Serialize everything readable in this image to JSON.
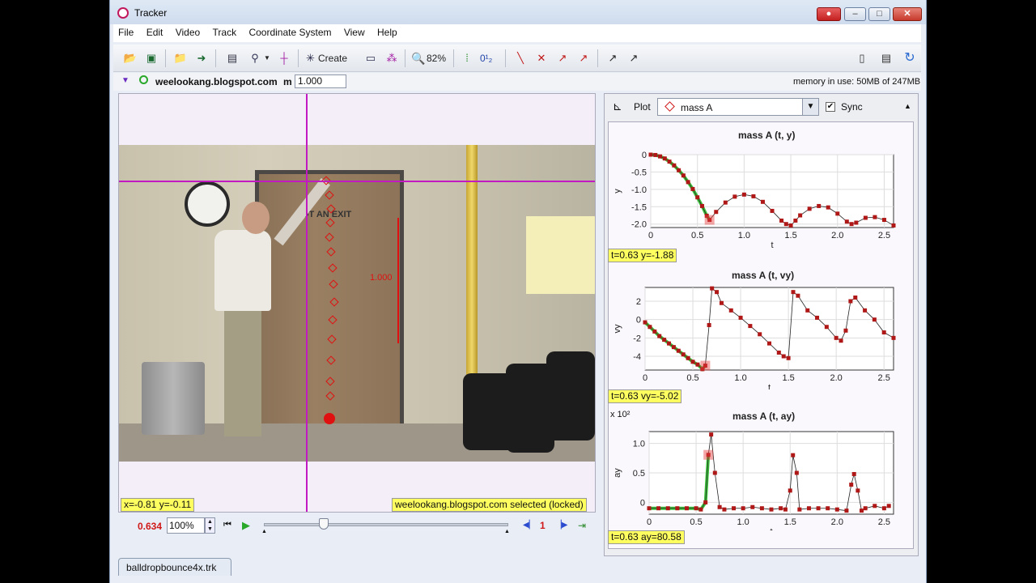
{
  "window": {
    "title": "Tracker"
  },
  "menu": [
    "File",
    "Edit",
    "Video",
    "Track",
    "Coordinate System",
    "View",
    "Help"
  ],
  "toolbar": {
    "create_label": "Create",
    "zoom": "82%",
    "coord_label": "0¹₂"
  },
  "trackbar": {
    "track_name": "weelookang.blogspot.com",
    "mass_label": "m",
    "mass_value": "1.000",
    "memory": "memory in use: 50MB of 247MB"
  },
  "video": {
    "door_text": "NOT AN EXIT",
    "scale_length": "1.000",
    "readout_xy": "x=-0.81  y=-0.11",
    "status": "weelookang.blogspot.com selected (locked)"
  },
  "playback": {
    "time": "0.634",
    "zoom": "100%",
    "step": "1"
  },
  "file_tab": "balldropbounce4x.trk",
  "plot_panel": {
    "plot_label": "Plot",
    "track": "mass A",
    "sync_label": "Sync",
    "plots": [
      {
        "title": "mass A (t, y)",
        "ylabel": "y",
        "xlabel": "t",
        "readout": "t=0.63  y=-1.88"
      },
      {
        "title": "mass A (t, vy)",
        "ylabel": "vy",
        "xlabel": "t",
        "readout": "t=0.63  vy=-5.02"
      },
      {
        "title": "mass A (t, ay)",
        "ylabel": "ay",
        "xlabel": "t",
        "readout": "t=0.63  ay=80.58",
        "scale": "x 10²"
      }
    ]
  },
  "chart_data": [
    {
      "type": "scatter",
      "title": "mass A (t, y)",
      "xlabel": "t",
      "ylabel": "y",
      "xlim": [
        0,
        2.6
      ],
      "ylim": [
        -2.1,
        0
      ],
      "x": [
        0,
        0.05,
        0.1,
        0.15,
        0.2,
        0.25,
        0.3,
        0.35,
        0.4,
        0.45,
        0.5,
        0.55,
        0.6,
        0.63,
        0.7,
        0.8,
        0.9,
        1.0,
        1.1,
        1.2,
        1.3,
        1.4,
        1.45,
        1.5,
        1.55,
        1.6,
        1.7,
        1.8,
        1.9,
        2.0,
        2.1,
        2.15,
        2.2,
        2.3,
        2.4,
        2.5,
        2.6
      ],
      "y": [
        0,
        -0.01,
        -0.05,
        -0.11,
        -0.2,
        -0.31,
        -0.45,
        -0.6,
        -0.79,
        -0.99,
        -1.23,
        -1.48,
        -1.76,
        -1.88,
        -1.65,
        -1.38,
        -1.21,
        -1.15,
        -1.2,
        -1.36,
        -1.62,
        -1.9,
        -2.0,
        -2.04,
        -1.9,
        -1.75,
        -1.56,
        -1.48,
        -1.52,
        -1.7,
        -1.93,
        -2.0,
        -1.96,
        -1.82,
        -1.8,
        -1.88,
        -2.04
      ]
    },
    {
      "type": "scatter",
      "title": "mass A (t, vy)",
      "xlabel": "t",
      "ylabel": "vy",
      "xlim": [
        0,
        2.6
      ],
      "ylim": [
        -5.5,
        3.5
      ],
      "x": [
        0,
        0.05,
        0.1,
        0.15,
        0.2,
        0.25,
        0.3,
        0.35,
        0.4,
        0.45,
        0.5,
        0.55,
        0.6,
        0.63,
        0.67,
        0.7,
        0.75,
        0.8,
        0.9,
        1.0,
        1.1,
        1.2,
        1.3,
        1.4,
        1.45,
        1.5,
        1.55,
        1.6,
        1.7,
        1.8,
        1.9,
        2.0,
        2.05,
        2.1,
        2.15,
        2.2,
        2.3,
        2.4,
        2.5,
        2.6
      ],
      "y": [
        -0.3,
        -0.8,
        -1.3,
        -1.8,
        -2.2,
        -2.6,
        -3.0,
        -3.4,
        -3.8,
        -4.2,
        -4.6,
        -4.9,
        -5.4,
        -5.02,
        -0.6,
        3.4,
        3.0,
        1.8,
        1.0,
        0.2,
        -0.7,
        -1.6,
        -2.6,
        -3.6,
        -4.0,
        -4.2,
        3.0,
        2.6,
        1.0,
        0.2,
        -0.8,
        -2.0,
        -2.3,
        -1.2,
        2.0,
        2.4,
        1.0,
        0.0,
        -1.4,
        -2.0
      ]
    },
    {
      "type": "scatter",
      "title": "mass A (t, ay)",
      "xlabel": "t",
      "ylabel": "ay",
      "xlim": [
        0,
        2.6
      ],
      "ylim": [
        -0.2,
        1.2
      ],
      "x": [
        0,
        0.1,
        0.2,
        0.3,
        0.4,
        0.5,
        0.55,
        0.6,
        0.63,
        0.66,
        0.7,
        0.75,
        0.8,
        0.9,
        1.0,
        1.1,
        1.2,
        1.3,
        1.4,
        1.45,
        1.5,
        1.53,
        1.57,
        1.6,
        1.7,
        1.8,
        1.9,
        2.0,
        2.1,
        2.15,
        2.18,
        2.22,
        2.26,
        2.3,
        2.4,
        2.5,
        2.55
      ],
      "y": [
        -0.1,
        -0.1,
        -0.1,
        -0.1,
        -0.1,
        -0.1,
        -0.12,
        0.0,
        0.8058,
        1.15,
        0.5,
        -0.08,
        -0.12,
        -0.1,
        -0.1,
        -0.08,
        -0.1,
        -0.12,
        -0.1,
        -0.12,
        0.2,
        0.8,
        0.5,
        -0.12,
        -0.1,
        -0.1,
        -0.1,
        -0.12,
        -0.14,
        0.3,
        0.48,
        0.2,
        -0.14,
        -0.1,
        -0.06,
        -0.1,
        -0.06
      ]
    }
  ]
}
